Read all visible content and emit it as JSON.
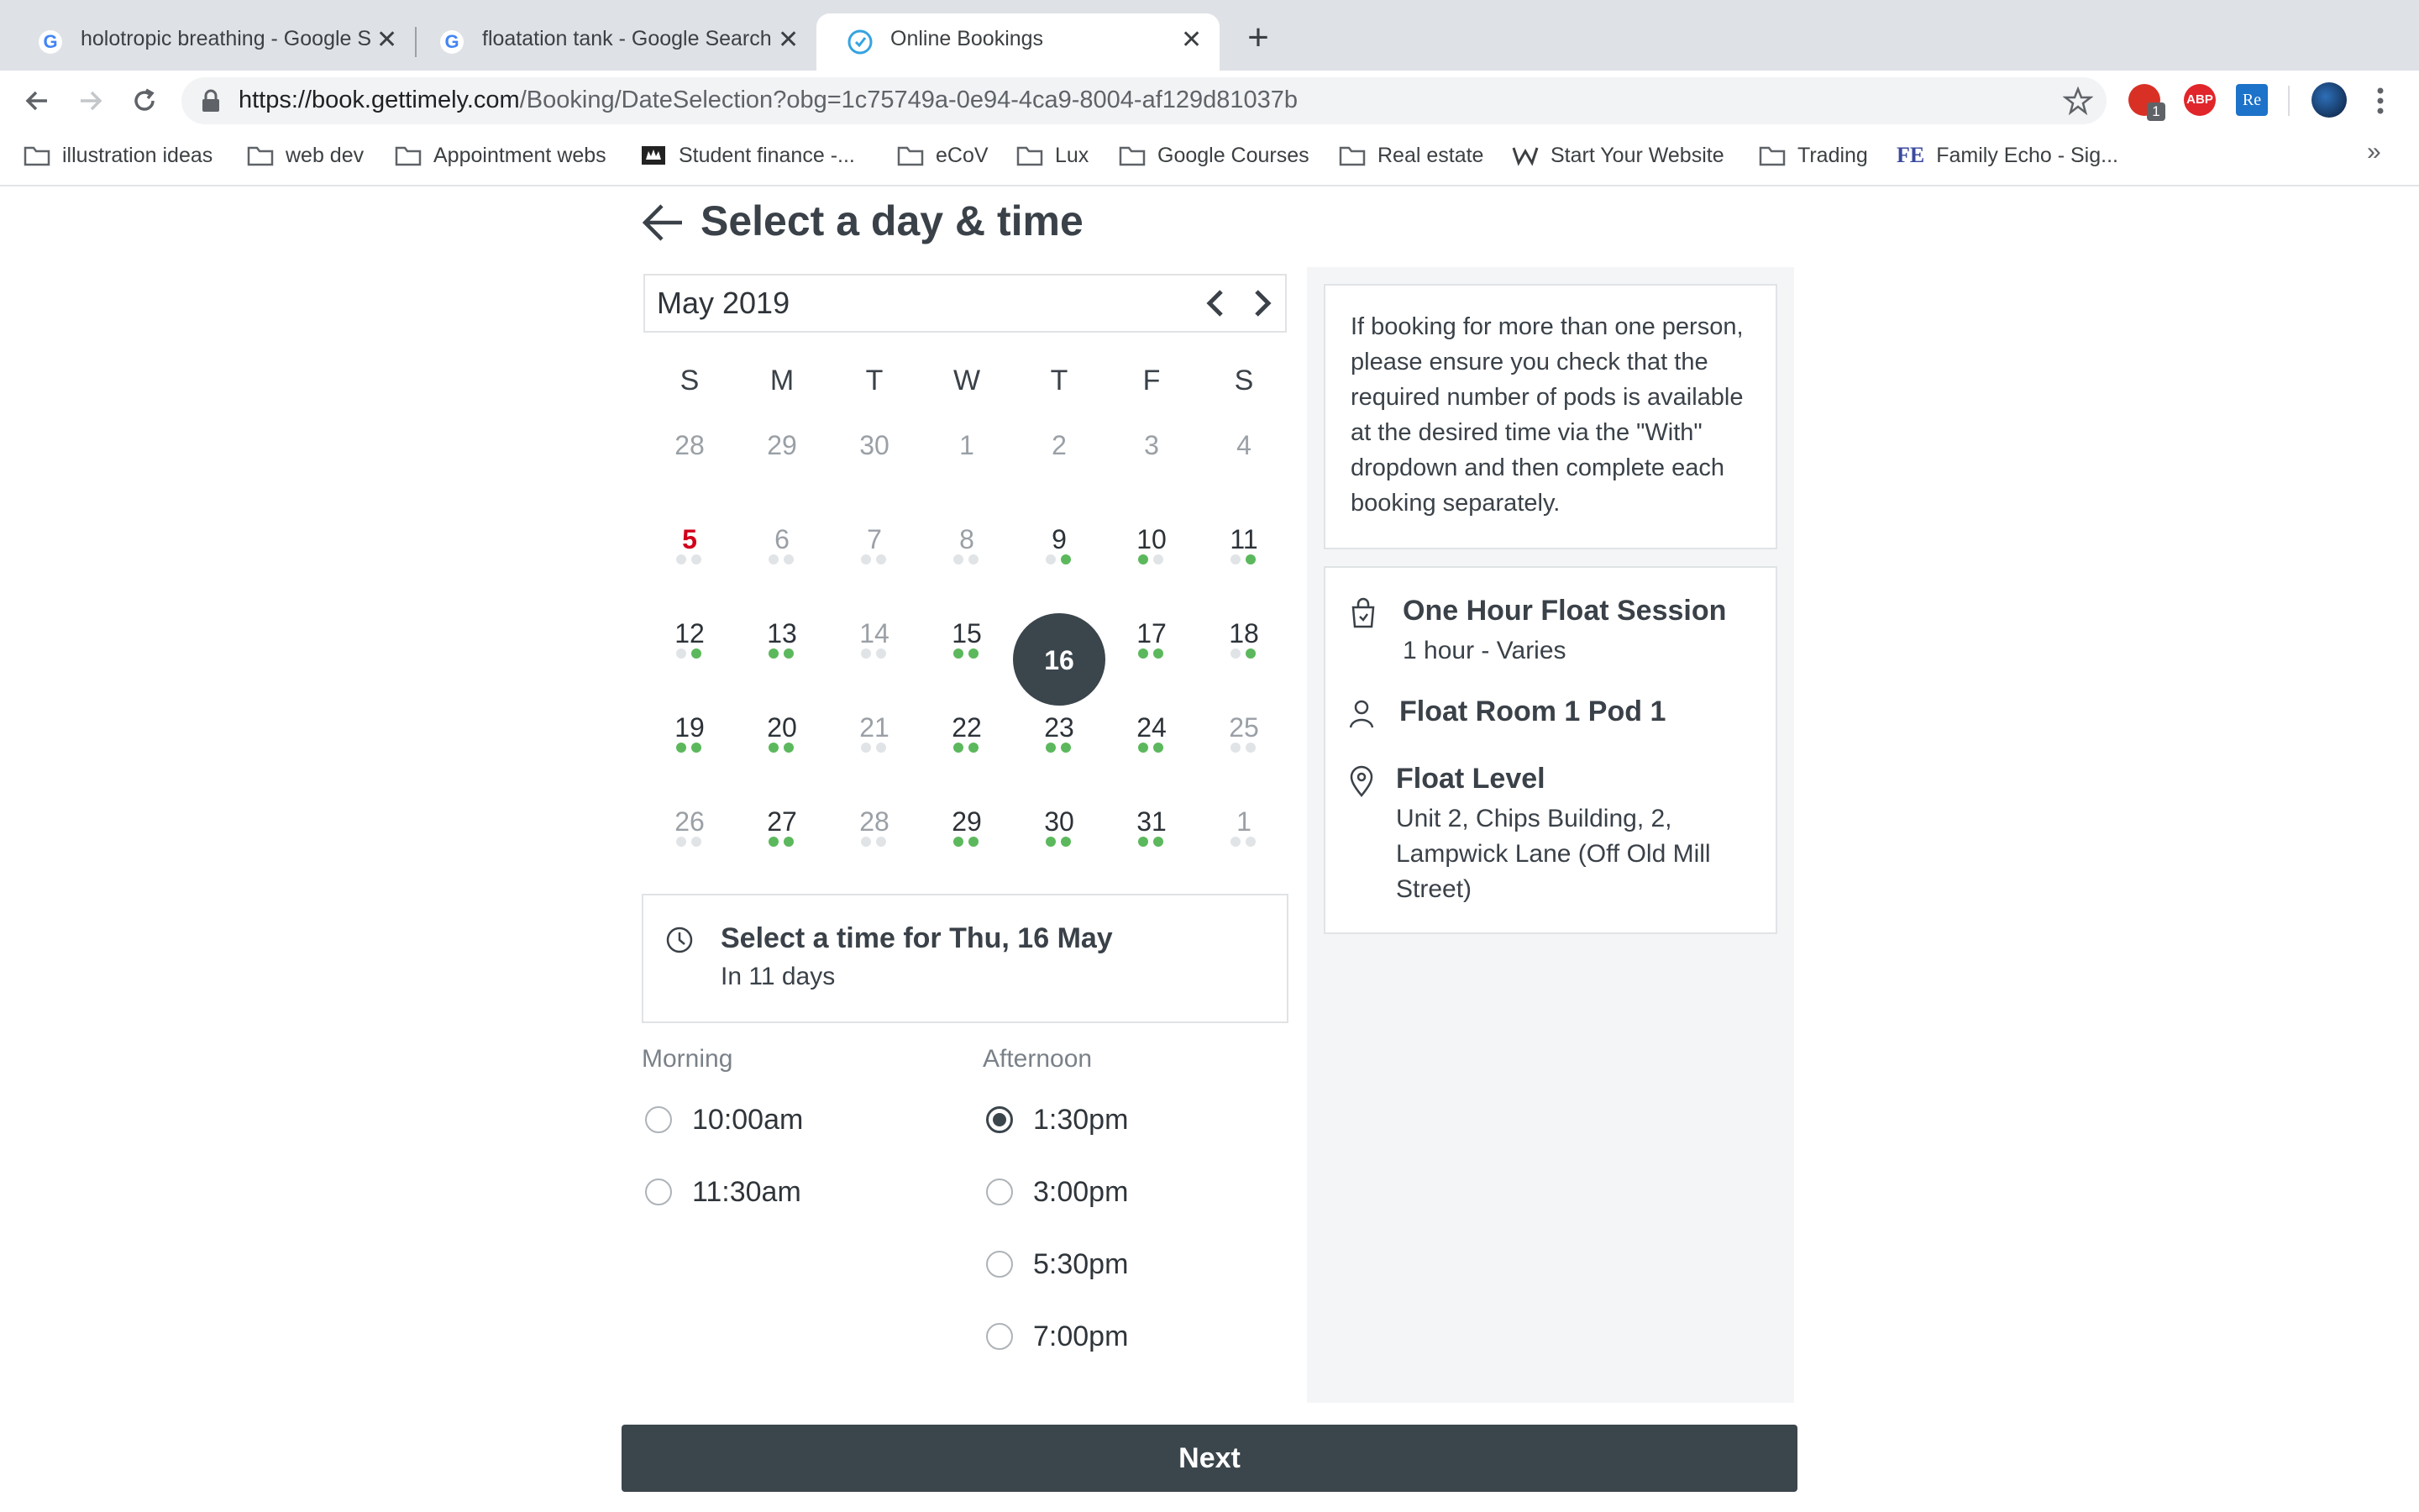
{
  "browser": {
    "tabs": [
      {
        "title": "holotropic breathing - Google S",
        "icon": "google-icon"
      },
      {
        "title": "floatation tank - Google Search",
        "icon": "google-icon"
      },
      {
        "title": "Online Bookings",
        "icon": "timely-icon"
      }
    ],
    "close_glyph": "✕",
    "new_tab_glyph": "+",
    "url_host": "https://book.gettimely.com",
    "url_path": "/Booking/DateSelection?obg=1c75749a-0e94-4ca9-8004-af129d81037b",
    "extensions": [
      {
        "name": "ublock-icon",
        "badge": "1"
      },
      {
        "name": "adblock-icon",
        "label": "ABP"
      },
      {
        "name": "readwise-icon",
        "label": "Re"
      }
    ],
    "bookmarks": [
      {
        "label": "illustration ideas",
        "icon": "folder-icon"
      },
      {
        "label": "web dev",
        "icon": "folder-icon"
      },
      {
        "label": "Appointment webs",
        "icon": "folder-icon"
      },
      {
        "label": "Student finance -...",
        "icon": "student-finance-icon"
      },
      {
        "label": "eCoV",
        "icon": "folder-icon"
      },
      {
        "label": "Lux",
        "icon": "folder-icon"
      },
      {
        "label": "Google Courses",
        "icon": "folder-icon"
      },
      {
        "label": "Real estate",
        "icon": "folder-icon"
      },
      {
        "label": "Start Your Website",
        "icon": "weebly-icon"
      },
      {
        "label": "Trading",
        "icon": "folder-icon"
      },
      {
        "label": "Family Echo - Sig...",
        "icon": "family-echo-icon",
        "icon_text": "FE"
      }
    ],
    "overflow": "»"
  },
  "page": {
    "title": "Select a day & time",
    "month": "May 2019",
    "weekdays": [
      "S",
      "M",
      "T",
      "W",
      "T",
      "F",
      "S"
    ],
    "weeks": [
      [
        {
          "d": "28",
          "s": "muted"
        },
        {
          "d": "29",
          "s": "muted"
        },
        {
          "d": "30",
          "s": "muted"
        },
        {
          "d": "1",
          "s": "muted"
        },
        {
          "d": "2",
          "s": "muted"
        },
        {
          "d": "3",
          "s": "muted"
        },
        {
          "d": "4",
          "s": "muted"
        }
      ],
      [
        {
          "d": "5",
          "s": "today",
          "dots": [
            0,
            0
          ]
        },
        {
          "d": "6",
          "s": "muted",
          "dots": [
            0,
            0
          ]
        },
        {
          "d": "7",
          "s": "muted",
          "dots": [
            0,
            0
          ]
        },
        {
          "d": "8",
          "s": "muted",
          "dots": [
            0,
            0
          ]
        },
        {
          "d": "9",
          "s": "avail",
          "dots": [
            0,
            1
          ]
        },
        {
          "d": "10",
          "s": "avail",
          "dots": [
            1,
            0
          ]
        },
        {
          "d": "11",
          "s": "avail",
          "dots": [
            0,
            1
          ]
        }
      ],
      [
        {
          "d": "12",
          "s": "avail",
          "dots": [
            0,
            1
          ]
        },
        {
          "d": "13",
          "s": "avail",
          "dots": [
            1,
            1
          ]
        },
        {
          "d": "14",
          "s": "muted",
          "dots": [
            0,
            0
          ]
        },
        {
          "d": "15",
          "s": "avail",
          "dots": [
            1,
            1
          ]
        },
        {
          "d": "16",
          "s": "selected"
        },
        {
          "d": "17",
          "s": "avail",
          "dots": [
            1,
            1
          ]
        },
        {
          "d": "18",
          "s": "avail",
          "dots": [
            0,
            1
          ]
        }
      ],
      [
        {
          "d": "19",
          "s": "avail",
          "dots": [
            1,
            1
          ]
        },
        {
          "d": "20",
          "s": "avail",
          "dots": [
            1,
            1
          ]
        },
        {
          "d": "21",
          "s": "muted",
          "dots": [
            0,
            0
          ]
        },
        {
          "d": "22",
          "s": "avail",
          "dots": [
            1,
            1
          ]
        },
        {
          "d": "23",
          "s": "avail",
          "dots": [
            1,
            1
          ]
        },
        {
          "d": "24",
          "s": "avail",
          "dots": [
            1,
            1
          ]
        },
        {
          "d": "25",
          "s": "muted",
          "dots": [
            0,
            0
          ]
        }
      ],
      [
        {
          "d": "26",
          "s": "muted",
          "dots": [
            0,
            0
          ]
        },
        {
          "d": "27",
          "s": "avail",
          "dots": [
            1,
            1
          ]
        },
        {
          "d": "28",
          "s": "muted",
          "dots": [
            0,
            0
          ]
        },
        {
          "d": "29",
          "s": "avail",
          "dots": [
            1,
            1
          ]
        },
        {
          "d": "30",
          "s": "avail",
          "dots": [
            1,
            1
          ]
        },
        {
          "d": "31",
          "s": "avail",
          "dots": [
            1,
            1
          ]
        },
        {
          "d": "1",
          "s": "muted",
          "dots": [
            0,
            0
          ]
        }
      ]
    ],
    "time_heading": "Select a time for Thu, 16 May",
    "time_sub": "In 11 days",
    "morning_label": "Morning",
    "afternoon_label": "Afternoon",
    "morning_slots": [
      {
        "label": "10:00am",
        "checked": false
      },
      {
        "label": "11:30am",
        "checked": false
      }
    ],
    "afternoon_slots": [
      {
        "label": "1:30pm",
        "checked": true
      },
      {
        "label": "3:00pm",
        "checked": false
      },
      {
        "label": "5:30pm",
        "checked": false
      },
      {
        "label": "7:00pm",
        "checked": false
      }
    ],
    "next_label": "Next"
  },
  "sidebar": {
    "notice": "If booking for more than one person, please ensure you check that the required number of pods is available at the desired time via the \"With\" dropdown and then complete each booking separately.",
    "service_title": "One Hour Float Session",
    "service_sub": "1 hour - Varies",
    "staff_title": "Float Room 1 Pod 1",
    "location_title": "Float Level",
    "location_address": "Unit 2, Chips Building, 2, Lampwick Lane (Off Old Mill Street)"
  },
  "colors": {
    "accent_dark": "#3b454c",
    "available_dot": "#5cb85c",
    "today_red": "#d0021b"
  }
}
